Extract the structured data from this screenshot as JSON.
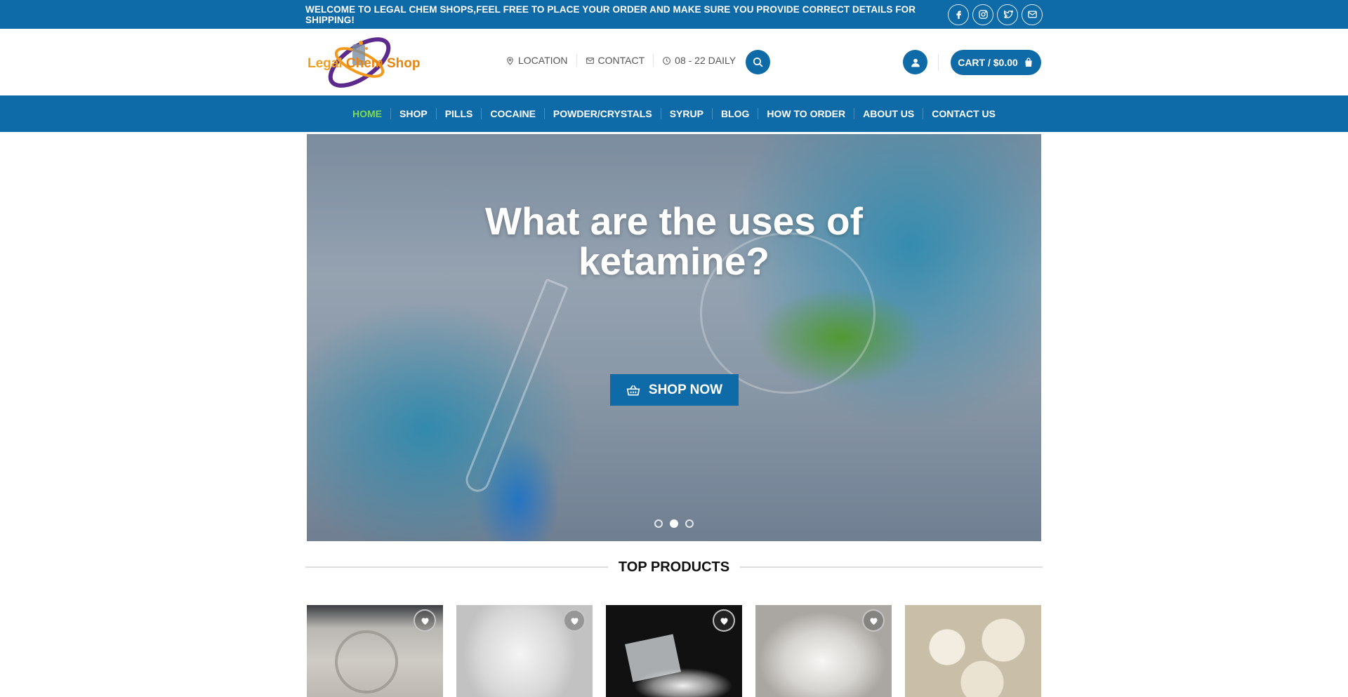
{
  "topbar": {
    "welcome_text": "WELCOME TO LEGAL CHEM SHOPS,FEEL FREE TO PLACE YOUR ORDER AND MAKE SURE YOU PROVIDE CORRECT DETAILS FOR SHIPPING!",
    "social_icons": [
      "facebook-icon",
      "instagram-icon",
      "twitter-icon",
      "email-icon"
    ]
  },
  "header": {
    "logo_part1": "Legal",
    "logo_part2": "Chem Shop",
    "links": [
      {
        "label": "LOCATION",
        "icon": "map-pin-icon"
      },
      {
        "label": "CONTACT",
        "icon": "envelope-icon"
      },
      {
        "label": "08 - 22 DAILY",
        "icon": "clock-icon"
      }
    ],
    "cart_label": "CART / $0.00"
  },
  "nav": {
    "items": [
      "HOME",
      "SHOP",
      "PILLS",
      "COCAINE",
      "POWDER/CRYSTALS",
      "SYRUP",
      "BLOG",
      "HOW TO ORDER",
      "ABOUT US",
      "CONTACT US"
    ],
    "active_index": 0
  },
  "hero": {
    "title": "What are the uses of ketamine?",
    "cta_label": "SHOP NOW",
    "slide_count": 3,
    "active_slide": 2
  },
  "section": {
    "title": "TOP PRODUCTS"
  },
  "colors": {
    "primary": "#0f6aa8",
    "nav_active": "#7ed957"
  }
}
